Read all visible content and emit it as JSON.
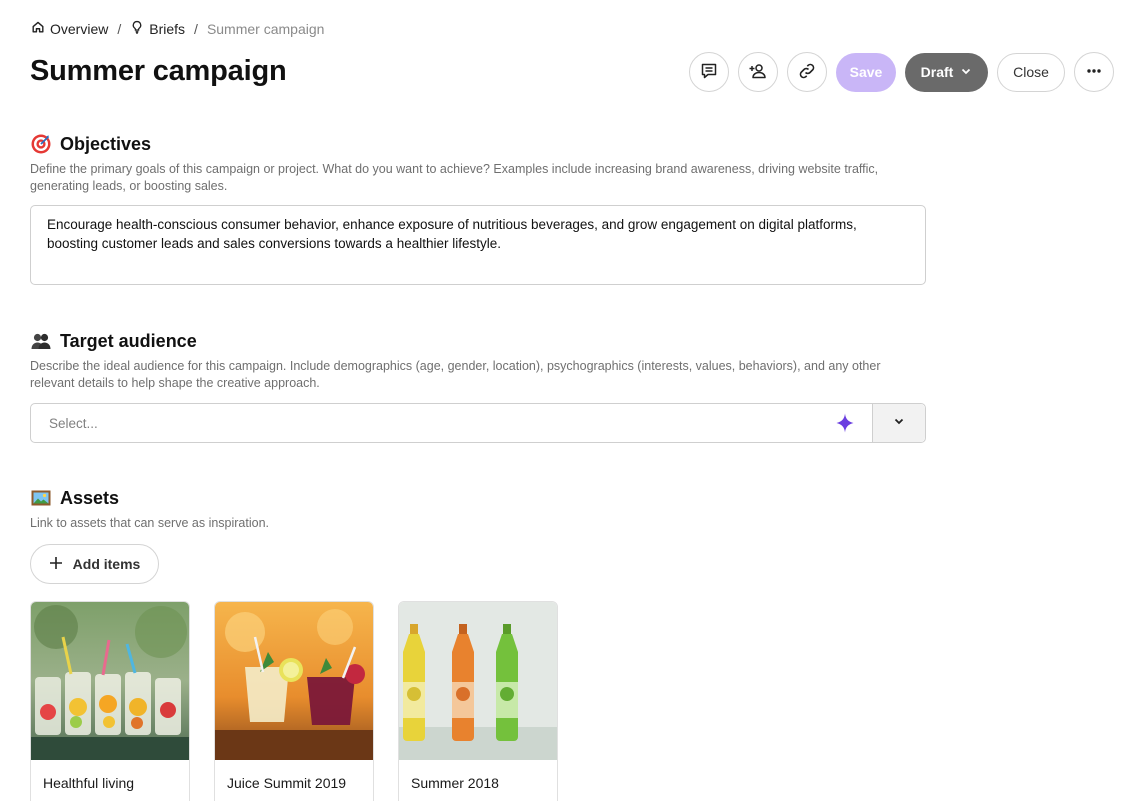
{
  "breadcrumb": {
    "home": "Overview",
    "briefs": "Briefs",
    "current": "Summer campaign"
  },
  "page": {
    "title": "Summer campaign"
  },
  "toolbar": {
    "save_label": "Save",
    "draft_label": "Draft",
    "close_label": "Close"
  },
  "objectives": {
    "icon": "target-icon",
    "title": "Objectives",
    "description": "Define the primary goals of this campaign or project. What do you want to achieve? Examples include increasing brand awareness, driving website traffic, generating leads, or boosting sales.",
    "value": "Encourage health-conscious consumer behavior, enhance exposure of nutritious beverages, and grow engagement on digital platforms, boosting customer leads and sales conversions towards a healthier lifestyle."
  },
  "audience": {
    "icon": "people-icon",
    "title": "Target audience",
    "description": "Describe the ideal audience for this campaign. Include demographics (age, gender, location), psychographics (interests, values, behaviors), and any other relevant details to help shape the creative approach.",
    "placeholder": "Select..."
  },
  "assets": {
    "icon": "framed-picture-icon",
    "title": "Assets",
    "description": "Link to assets that can serve as inspiration.",
    "add_label": "Add items",
    "items": [
      {
        "label": "Healthful living"
      },
      {
        "label": "Juice Summit 2019"
      },
      {
        "label": "Summer 2018"
      }
    ]
  },
  "colors": {
    "accent": "#6b3fe0",
    "save_disabled": "#c9b6f7",
    "draft": "#6a6a6a"
  }
}
